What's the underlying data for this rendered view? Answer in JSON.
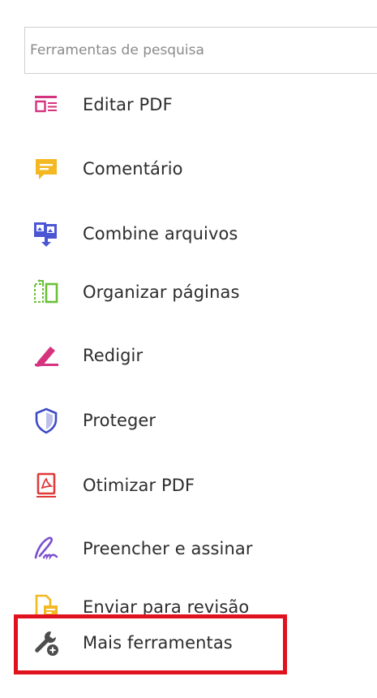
{
  "search": {
    "placeholder": "Ferramentas de pesquisa",
    "value": ""
  },
  "tools": [
    {
      "label": "Editar PDF",
      "icon": "edit-pdf-icon",
      "color": "#d6337f"
    },
    {
      "label": "Comentário",
      "icon": "comment-icon",
      "color": "#f3b822"
    },
    {
      "label": "Combine arquivos",
      "icon": "combine-files-icon",
      "color": "#4b56d2"
    },
    {
      "label": "Organizar páginas",
      "icon": "organize-pages-icon",
      "color": "#6cbf3a"
    },
    {
      "label": "Redigir",
      "icon": "redact-icon",
      "color": "#d6337f"
    },
    {
      "label": "Proteger",
      "icon": "protect-shield-icon",
      "color": "#3f4bc4"
    },
    {
      "label": "Otimizar PDF",
      "icon": "optimize-pdf-icon",
      "color": "#e03a3a"
    },
    {
      "label": "Preencher e assinar",
      "icon": "fill-sign-icon",
      "color": "#7a4fcf"
    },
    {
      "label": "Enviar para revisão",
      "icon": "send-review-icon",
      "color": "#f3b822"
    },
    {
      "label": "Mais ferramentas",
      "icon": "more-tools-icon",
      "color": "#4d4d4d"
    }
  ],
  "highlight_color": "#e0121e"
}
